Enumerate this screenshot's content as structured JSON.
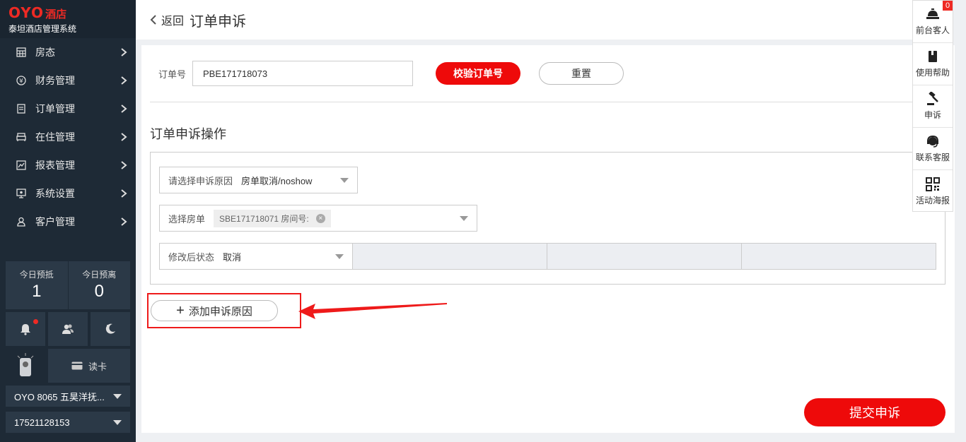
{
  "sidebar": {
    "logo_brand": "OYO",
    "logo_hotel": "酒店",
    "logo_sub": "泰坦酒店管理系统",
    "nav": [
      {
        "label": "房态",
        "icon": "grid-icon"
      },
      {
        "label": "财务管理",
        "icon": "yen-icon"
      },
      {
        "label": "订单管理",
        "icon": "order-list-icon"
      },
      {
        "label": "在住管理",
        "icon": "bed-icon"
      },
      {
        "label": "报表管理",
        "icon": "chart-icon"
      },
      {
        "label": "系统设置",
        "icon": "settings-monitor-icon"
      },
      {
        "label": "客户管理",
        "icon": "person-icon"
      }
    ],
    "stats": {
      "arrive_label": "今日预抵",
      "arrive_value": "1",
      "depart_label": "今日预离",
      "depart_value": "0"
    },
    "read_card_label": "读卡",
    "hotel_select": "OYO 8065 五昊洋抚...",
    "phone_select": "17521128153"
  },
  "header": {
    "back_label": "返回",
    "title": "订单申诉"
  },
  "rail": {
    "badge": "0",
    "items": [
      "前台客人",
      "使用帮助",
      "申诉",
      "联系客服",
      "活动海报"
    ]
  },
  "main": {
    "order_label": "订单号",
    "order_value": "PBE171718073",
    "verify_button": "校验订单号",
    "reset_button": "重置",
    "section_title": "订单申诉操作",
    "reason_label": "请选择申诉原因",
    "reason_value": "房单取消/noshow",
    "room_label": "选择房单",
    "room_chip": "SBE171718071 房间号:",
    "status_label": "修改后状态",
    "status_value": "取消",
    "add_reason_button": "添加申诉原因",
    "submit_button": "提交申诉"
  },
  "colors": {
    "accent_red": "#ee0a0a",
    "sidebar_bg": "#1e2a36"
  }
}
